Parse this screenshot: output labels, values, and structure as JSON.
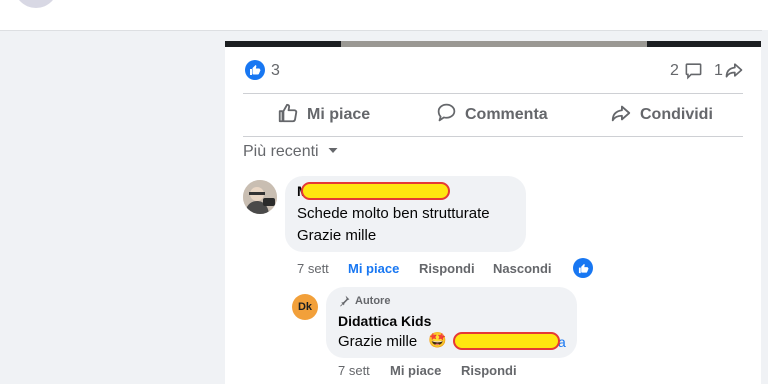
{
  "post": {
    "reactions_count": "3",
    "comments_count": "2",
    "shares_count": "1",
    "actions": {
      "like": "Mi piace",
      "comment": "Commenta",
      "share": "Condividi"
    },
    "sort_label": "Più recenti"
  },
  "comments": [
    {
      "author_initial": "M",
      "lines": [
        "Schede molto ben strutturate",
        "Grazie mille"
      ],
      "time": "7 sett",
      "like": "Mi piace",
      "reply": "Rispondi",
      "hide": "Nascondi"
    }
  ],
  "reply": {
    "badge": "Autore",
    "author": "Didattica Kids",
    "avatar_text": "Dk",
    "text": "Grazie mille",
    "emoji": "🤩",
    "tail": "a",
    "time": "7 sett",
    "like": "Mi piace",
    "reply": "Rispondi"
  },
  "colors": {
    "accent": "#1877f2",
    "muted": "#65676b",
    "bubble": "#f0f2f5",
    "redaction_fill": "#ffe60f",
    "redaction_border": "#e53935",
    "avatar_orange": "#f2a03a"
  }
}
